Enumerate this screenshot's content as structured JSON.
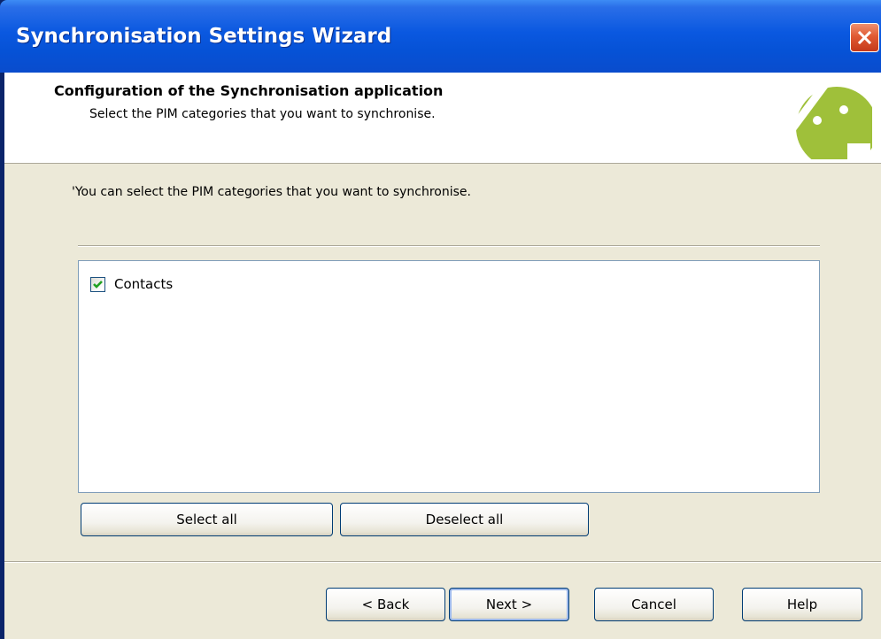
{
  "window": {
    "title": "Synchronisation Settings Wizard",
    "close_icon": "close-icon",
    "title_bar_color": "#0a58e0",
    "close_button_color": "#e05a33"
  },
  "header": {
    "title": "Configuration of the Synchronisation application",
    "subtitle": "Select the PIM categories that you want to synchronise.",
    "logo_icon": "android-logo-icon",
    "logo_color": "#9fc03a"
  },
  "main": {
    "instruction": "'You can select the PIM categories that you want to synchronise.",
    "categories": [
      {
        "label": "Contacts",
        "checked": true
      }
    ],
    "select_all_label": "Select all",
    "deselect_all_label": "Deselect all"
  },
  "footer": {
    "back_label": "< Back",
    "next_label": "Next >",
    "cancel_label": "Cancel",
    "help_label": "Help"
  }
}
